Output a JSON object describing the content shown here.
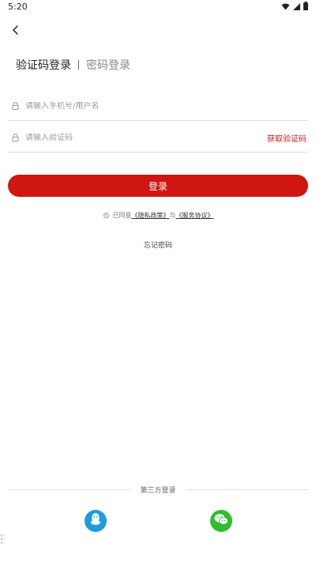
{
  "status_bar": {
    "time": "5:20"
  },
  "tabs": {
    "active": "验证码登录",
    "inactive": "密码登录"
  },
  "phone_field": {
    "placeholder": "请输入手机号/用户名",
    "value": ""
  },
  "code_field": {
    "placeholder": "请输入验证码",
    "value": "",
    "get_code_label": "获取验证码"
  },
  "login_button": {
    "label": "登录"
  },
  "agreement": {
    "prefix": "已同意",
    "privacy_link": "《隐私政策》",
    "connector": "与",
    "service_link": "《服务协议》"
  },
  "forgot_password": {
    "label": "忘记密码"
  },
  "third_party": {
    "label": "第三方登录"
  },
  "colors": {
    "accent": "#cf1612",
    "qq": "#1e9bdf",
    "wechat": "#2fbe2f"
  },
  "icons": {
    "back": "chevron-left-icon",
    "lock": "lock-icon",
    "check": "check-circle-icon",
    "qq": "qq-icon",
    "wechat": "wechat-icon",
    "wifi": "wifi-icon",
    "signal": "signal-icon",
    "battery": "battery-icon"
  }
}
